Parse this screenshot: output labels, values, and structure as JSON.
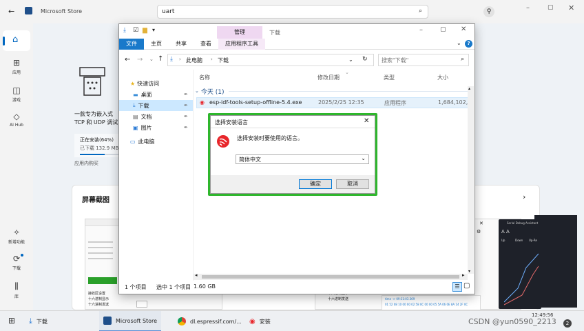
{
  "store": {
    "app_name": "Microsoft Store",
    "search_value": "uart",
    "nav": [
      {
        "label": "应用"
      },
      {
        "label": "游戏"
      },
      {
        "label": "AI Hub"
      },
      {
        "label": "新增功能"
      },
      {
        "label": "下载"
      },
      {
        "label": "库"
      }
    ],
    "desc_line1": "一款专为嵌入式",
    "desc_line2": "TCP 和 UDP 调试",
    "install_status": "正在安装(64%)",
    "install_progress": 0.64,
    "downloaded": "已下载 132.9 MB",
    "in_app_purchase": "应用内购买",
    "screenshots_title": "屏幕截图",
    "mini": {
      "row1": "接收区设置",
      "row2": "十六进制显示",
      "row3": "十六进制发送",
      "terminal": "time -> 09:31:03.369",
      "hex": "01 52 08 10 00 00 02 58 0C 00 00 05 5A 06 0E 8A 14 2F 0C",
      "tabs": [
        "Up",
        "Down",
        "Up-Re"
      ],
      "serial_title": "Serial Debug Assistant"
    }
  },
  "explorer": {
    "ribbon_context": "管理",
    "ribbon_title": "下载",
    "tabs": [
      "文件",
      "主页",
      "共享",
      "查看",
      "应用程序工具"
    ],
    "breadcrumb": [
      "此电脑",
      "下载"
    ],
    "search_placeholder": "搜索\"下载\"",
    "nav": {
      "quick_access": "快速访问",
      "items": [
        "桌面",
        "下载",
        "文档",
        "图片"
      ],
      "this_pc": "此电脑"
    },
    "columns": {
      "name": "名称",
      "modified": "修改日期",
      "type": "类型",
      "size": "大小"
    },
    "group": "今天 (1)",
    "file": {
      "name": "esp-idf-tools-setup-offline-5.4.exe",
      "modified": "2025/2/25 12:35",
      "type": "应用程序",
      "size": "1,684,102,"
    },
    "status": {
      "count": "1 个项目",
      "selected": "选中 1 个项目",
      "size": "1.60 GB"
    }
  },
  "dialog": {
    "title": "选择安装语言",
    "prompt": "选择安装时要使用的语言。",
    "selected_language": "简体中文",
    "ok": "确定",
    "cancel": "取消"
  },
  "taskbar": {
    "items": [
      "下载",
      "Microsoft Store",
      "dl.espressif.com/...",
      "安装"
    ],
    "time": "12:49:56",
    "watermark": "CSDN @yun0590_2213",
    "badge": "2"
  },
  "colors": {
    "accent": "#2eb62c",
    "store_blue": "#0067c0",
    "espressif_red": "#e8262b"
  }
}
